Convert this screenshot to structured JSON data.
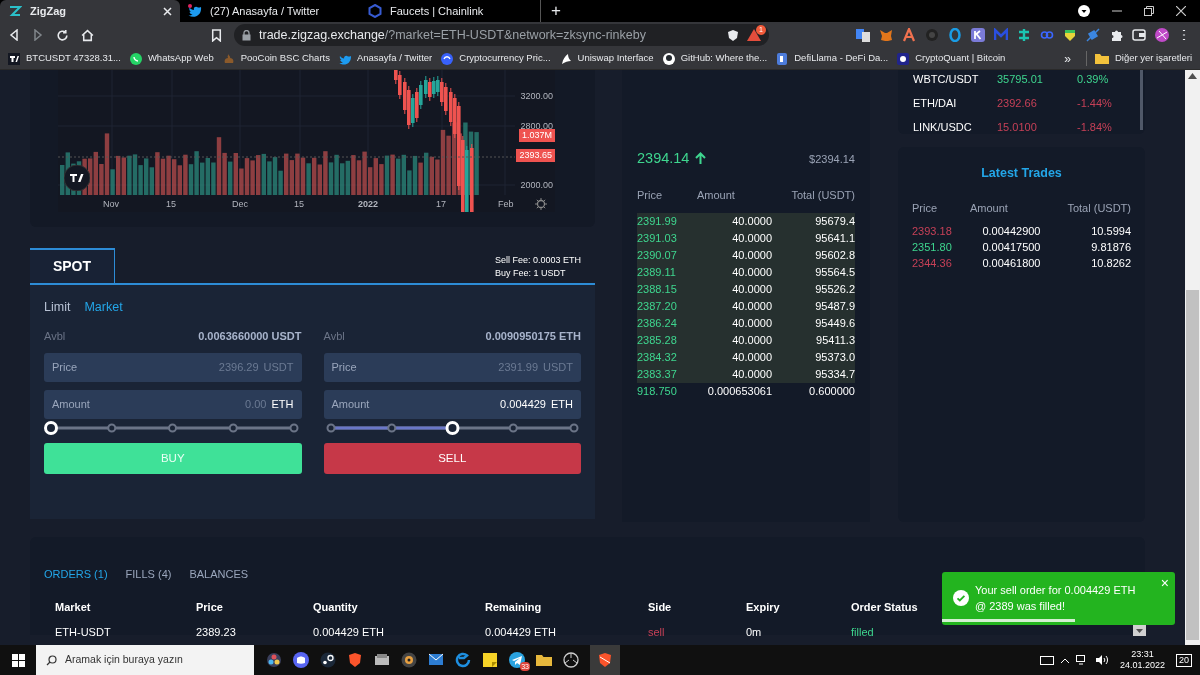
{
  "browser": {
    "tabs": [
      {
        "title": "ZigZag",
        "selected": true
      },
      {
        "title": "(27) Anasayfa / Twitter",
        "selected": false
      },
      {
        "title": "Faucets | Chainlink",
        "selected": false
      }
    ],
    "new_tab": "+",
    "address": {
      "host": "trade.zigzag.exchange",
      "path": "/?market=ETH-USDT&network=zksync-rinkeby"
    },
    "shield_badge": "1",
    "bookmarks": [
      "BTCUSDT 47328.31...",
      "WhatsApp Web",
      "PooCoin BSC Charts",
      "Anasayfa / Twitter",
      "Cryptocurrency Pric...",
      "Uniswap Interface",
      "GitHub: Where the...",
      "DefiLlama - DeFi Da...",
      "CryptoQuant | Bitcoin"
    ],
    "more_bookmarks": "»",
    "other_bookmarks": "Diğer yer işaretleri"
  },
  "chart": {
    "price_labels": [
      "3200.00",
      "2800.00",
      "2000.00"
    ],
    "volume_badge": "1.037M",
    "price_badge": "2393.65",
    "date_labels": [
      "Nov",
      "15",
      "Dec",
      "15",
      "2022",
      "17",
      "Feb"
    ]
  },
  "spot": {
    "title": "SPOT",
    "sell_fee": "Sell Fee: 0.0003 ETH",
    "buy_fee": "Buy Fee: 1 USDT",
    "order_types": [
      {
        "label": "Limit",
        "selected": false
      },
      {
        "label": "Market",
        "selected": true
      }
    ],
    "forms": [
      {
        "kind": "buy",
        "avbl_label": "Avbl",
        "avbl": "0.0063660000 USDT",
        "price_label": "Price",
        "price": "2396.29",
        "price_unit": "USDT",
        "amount_label": "Amount",
        "amount": "0.00",
        "amount_unit": "ETH",
        "amount_entered": false,
        "level": 0,
        "button": "BUY"
      },
      {
        "kind": "sell",
        "avbl_label": "Avbl",
        "avbl": "0.0090950175 ETH",
        "price_label": "Price",
        "price": "2391.99",
        "price_unit": "USDT",
        "amount_label": "Amount",
        "amount": "0.004429",
        "amount_unit": "ETH",
        "amount_entered": true,
        "level": 0.5,
        "button": "SELL"
      }
    ]
  },
  "orderbook": {
    "last_price": "2394.14",
    "last_price_usd": "$2394.14",
    "columns": [
      "Price",
      "Amount",
      "Total (USDT)"
    ],
    "rows": [
      {
        "price": "2391.99",
        "amount": "40.0000",
        "total": "95679.4",
        "highlighted": true
      },
      {
        "price": "2391.03",
        "amount": "40.0000",
        "total": "95641.1",
        "highlighted": true
      },
      {
        "price": "2390.07",
        "amount": "40.0000",
        "total": "95602.8",
        "highlighted": true
      },
      {
        "price": "2389.11",
        "amount": "40.0000",
        "total": "95564.5",
        "highlighted": true
      },
      {
        "price": "2388.15",
        "amount": "40.0000",
        "total": "95526.2",
        "highlighted": true
      },
      {
        "price": "2387.20",
        "amount": "40.0000",
        "total": "95487.9",
        "highlighted": true
      },
      {
        "price": "2386.24",
        "amount": "40.0000",
        "total": "95449.6",
        "highlighted": true
      },
      {
        "price": "2385.28",
        "amount": "40.0000",
        "total": "95411.3",
        "highlighted": true
      },
      {
        "price": "2384.32",
        "amount": "40.0000",
        "total": "95373.0",
        "highlighted": true
      },
      {
        "price": "2383.37",
        "amount": "40.0000",
        "total": "95334.7",
        "highlighted": true
      },
      {
        "price": "918.750",
        "amount": "0.000653061",
        "total": "0.600000",
        "highlighted": false
      }
    ]
  },
  "markets": [
    {
      "pair": "WBTC/USDT",
      "price": "35795.01",
      "change": "0.39%",
      "color": "#3ed68f"
    },
    {
      "pair": "ETH/DAI",
      "price": "2392.66",
      "change": "-1.44%",
      "color": "#c64057"
    },
    {
      "pair": "LINK/USDC",
      "price": "15.0100",
      "change": "-1.84%",
      "color": "#c64057"
    }
  ],
  "latest_trades": {
    "title": "Latest Trades",
    "columns": [
      "Price",
      "Amount",
      "Total (USDT)"
    ],
    "rows": [
      {
        "price": "2393.18",
        "amount": "0.00442900",
        "total": "10.5994",
        "kind": "sell"
      },
      {
        "price": "2351.80",
        "amount": "0.00417500",
        "total": "9.81876",
        "kind": "buy"
      },
      {
        "price": "2344.36",
        "amount": "0.00461800",
        "total": "10.8262",
        "kind": "sell"
      }
    ]
  },
  "orders": {
    "tabs": [
      {
        "label": "ORDERS (1)",
        "selected": true
      },
      {
        "label": "FILLS (4)",
        "selected": false
      },
      {
        "label": "BALANCES",
        "selected": false
      }
    ],
    "columns": [
      "Market",
      "Price",
      "Quantity",
      "Remaining",
      "Side",
      "Expiry",
      "Order Status"
    ],
    "rows": [
      {
        "market": "ETH-USDT",
        "price": "2389.23",
        "quantity": "0.004429 ETH",
        "remaining": "0.004429 ETH",
        "side": "sell",
        "kind": "sell",
        "expiry": "0m",
        "status": "filled"
      }
    ]
  },
  "toast": {
    "message": "Your sell order for 0.004429 ETH @ 2389 was filled!",
    "close": "×",
    "level": 0.57
  },
  "taskbar": {
    "search_placeholder": "Aramak için buraya yazın",
    "telegram_badge": "33",
    "time": "23:31",
    "date": "24.01.2022",
    "notification_count": "20"
  }
}
